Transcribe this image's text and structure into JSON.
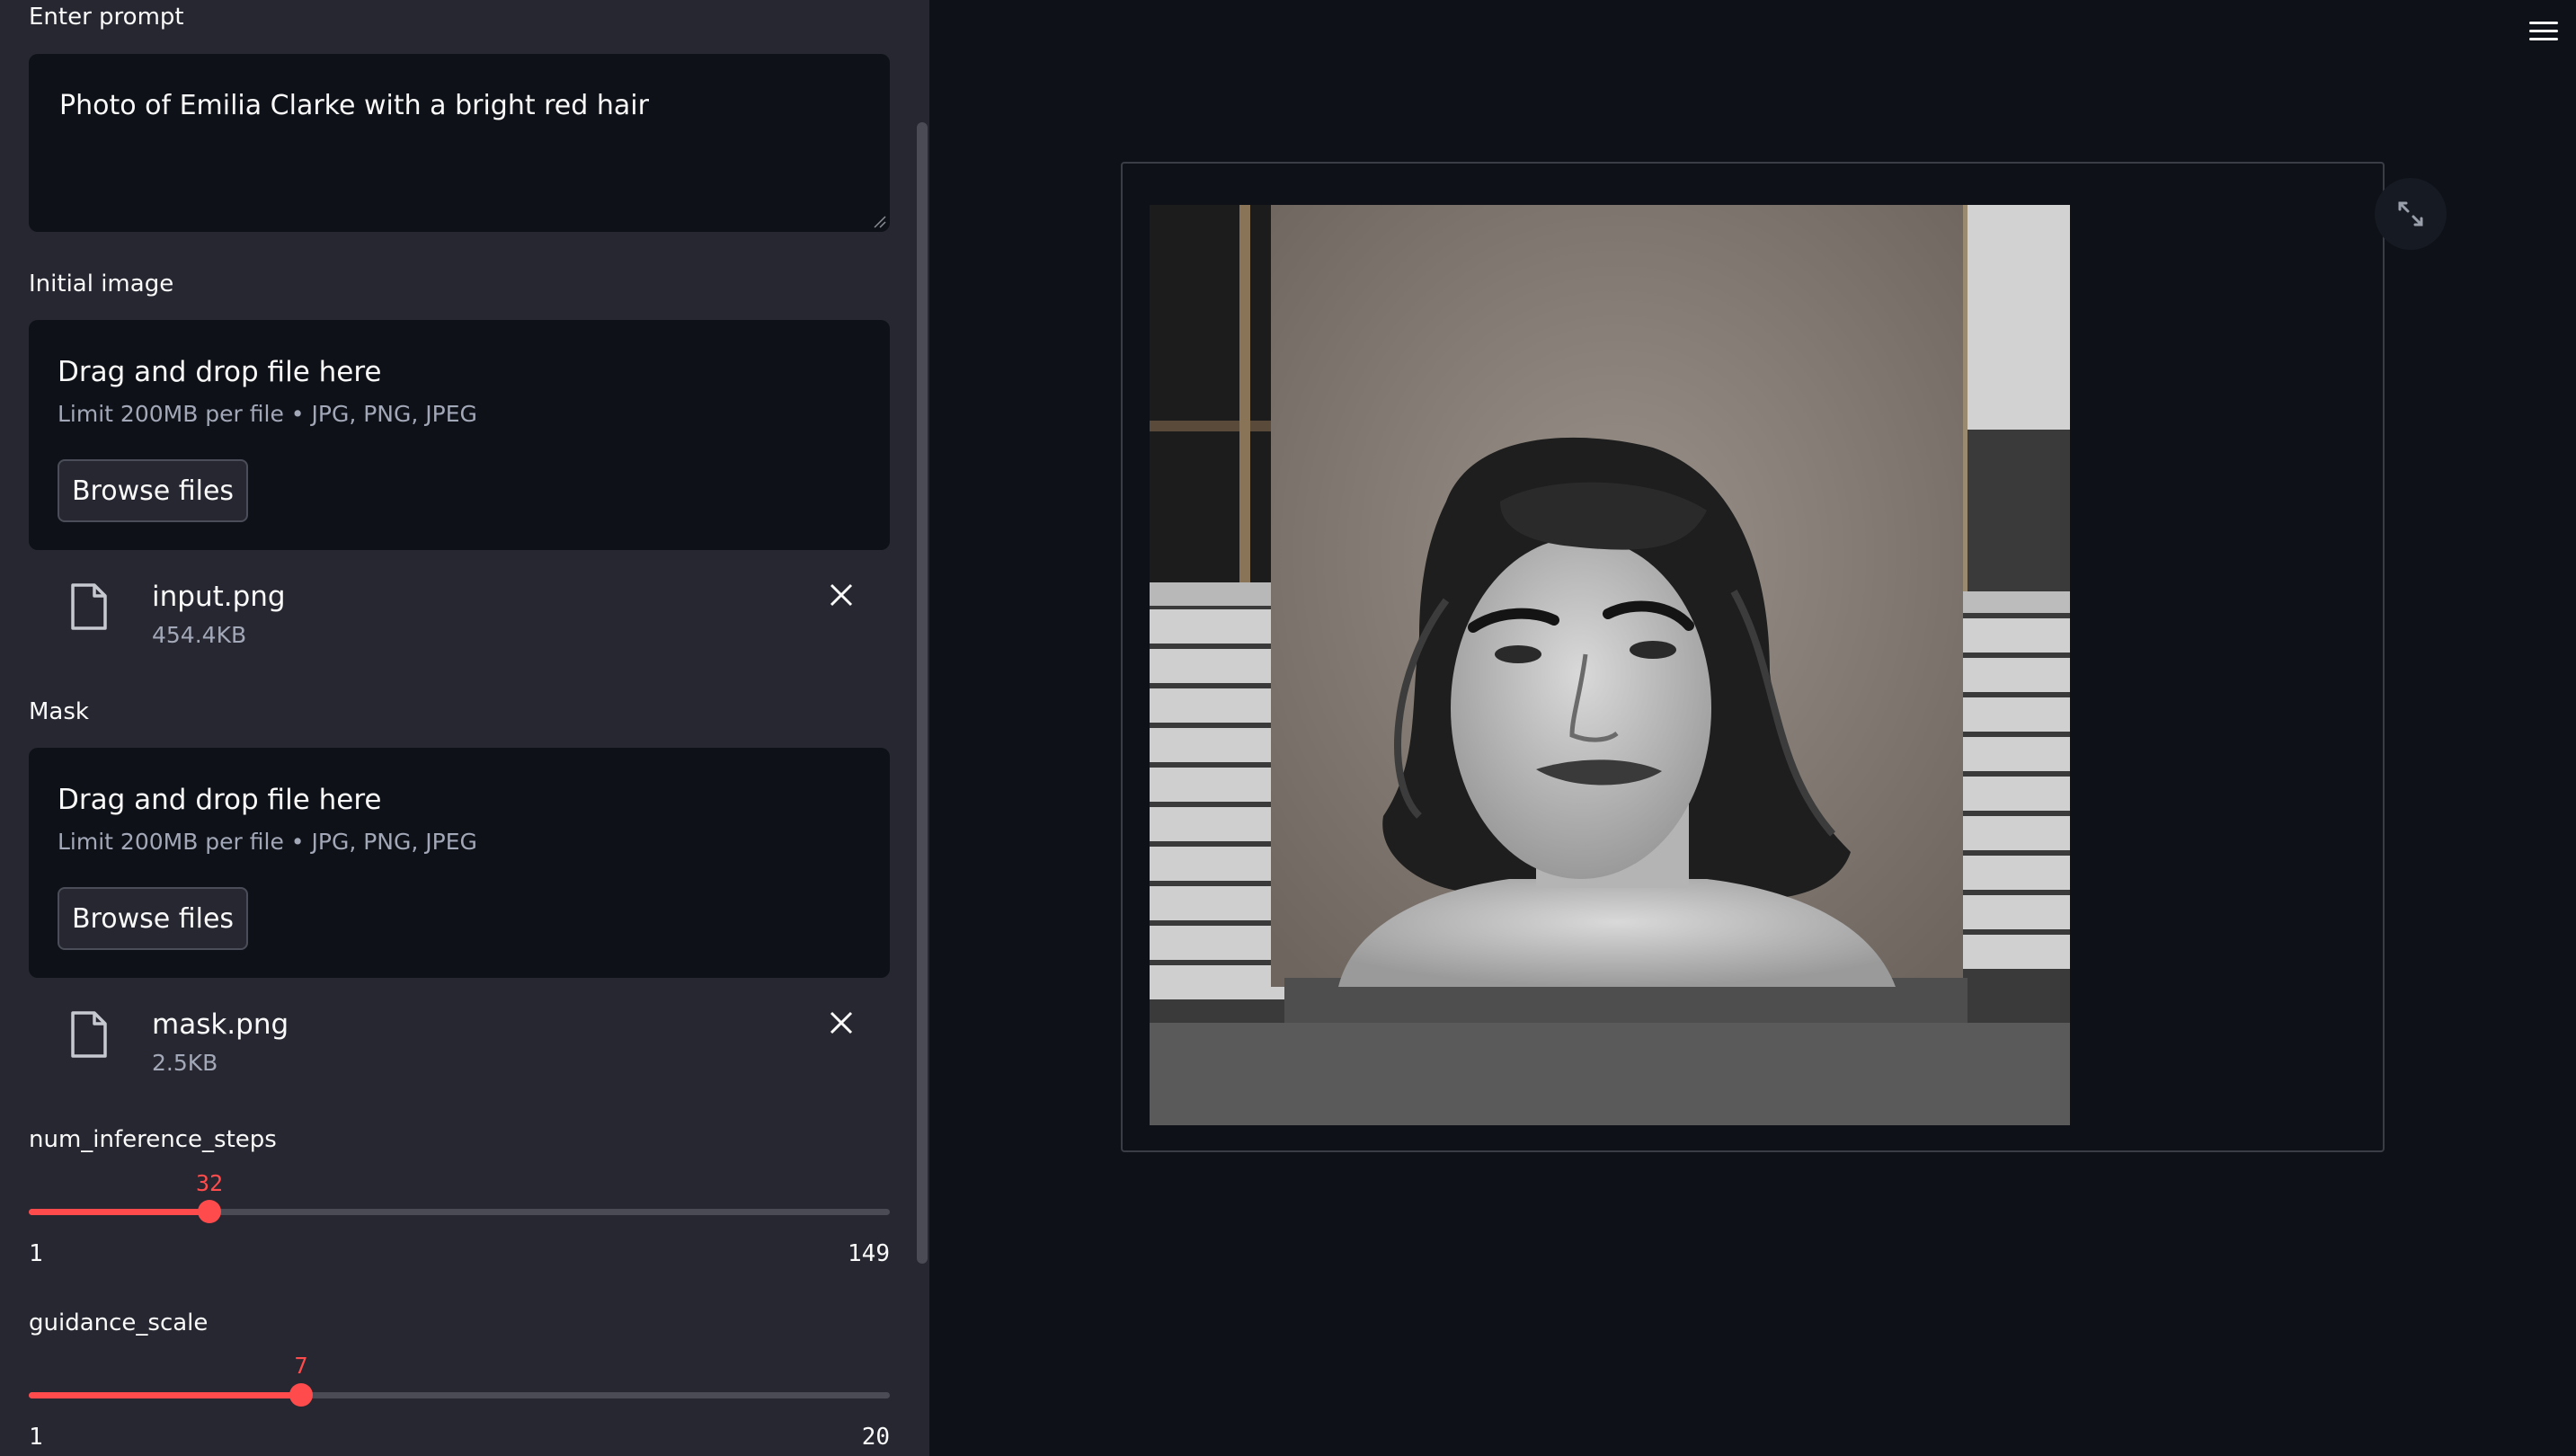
{
  "sidebar": {
    "prompt_label": "Enter prompt",
    "prompt_value": "Photo of Emilia Clarke with a bright red hair",
    "initial_image": {
      "label": "Initial image",
      "drop_title": "Drag and drop file here",
      "limit": "Limit 200MB per file • JPG, PNG, JPEG",
      "browse_label": "Browse files",
      "file": {
        "name": "input.png",
        "size": "454.4KB"
      }
    },
    "mask": {
      "label": "Mask",
      "drop_title": "Drag and drop file here",
      "limit": "Limit 200MB per file • JPG, PNG, JPEG",
      "browse_label": "Browse files",
      "file": {
        "name": "mask.png",
        "size": "2.5KB"
      }
    },
    "steps": {
      "label": "num_inference_steps",
      "value": "32",
      "min": "1",
      "max": "149",
      "fraction": 0.2095
    },
    "guidance": {
      "label": "guidance_scale",
      "value": "7",
      "min": "1",
      "max": "20",
      "fraction": 0.3158
    }
  },
  "main": {
    "image_alt": "Generated image result",
    "icons": {
      "menu": "hamburger-menu-icon",
      "expand": "fullscreen-expand-icon"
    }
  },
  "colors": {
    "accent": "#ff4b4b",
    "sidebar_bg": "#262730",
    "main_bg": "#0e1117"
  }
}
